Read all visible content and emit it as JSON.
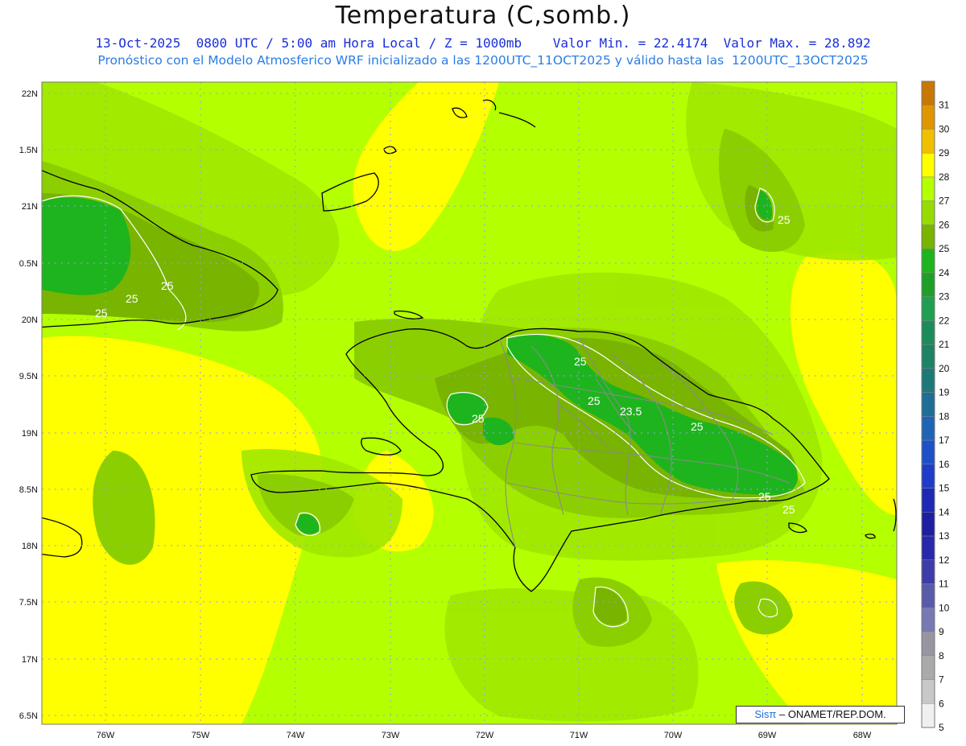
{
  "header": {
    "title": "Temperatura (C,somb.)",
    "line1": "13-Oct-2025  0800 UTC / 5:00 am Hora Local / Z = 1000mb    Valor Min. = 22.4174  Valor Max. = 28.892",
    "line2": "Pronóstico con el Modelo Atmosferico WRF inicializado a las 1200UTC_11OCT2025 y válido hasta las  1200UTC_13OCT2025"
  },
  "lat_labels": [
    "22N",
    "1.5N",
    "21N",
    "0.5N",
    "20N",
    "9.5N",
    "19N",
    "8.5N",
    "18N",
    "7.5N",
    "17N",
    "6.5N"
  ],
  "lon_labels": [
    "76W",
    "75W",
    "74W",
    "73W",
    "72W",
    "71W",
    "70W",
    "69W",
    "68W"
  ],
  "contour_labels": [
    "25",
    "25",
    "25",
    "25",
    "25",
    "25",
    "25",
    "23.5",
    "25",
    "25",
    "25"
  ],
  "colorbar": {
    "labels": [
      "31",
      "30",
      "29",
      "28",
      "27",
      "26",
      "25",
      "24",
      "23",
      "22",
      "21",
      "20",
      "19",
      "18",
      "17",
      "16",
      "15",
      "14",
      "13",
      "12",
      "11",
      "10",
      "9",
      "8",
      "7",
      "6",
      "5"
    ],
    "colors": [
      "#c87800",
      "#e09600",
      "#f0c000",
      "#ffff00",
      "#b4ff00",
      "#96dc00",
      "#78b400",
      "#1eb41e",
      "#1ea028",
      "#1ea050",
      "#1e8c5a",
      "#1e8264",
      "#1e7878",
      "#1e6e96",
      "#1e64b4",
      "#1e50c8",
      "#1e3cc8",
      "#1e28b4",
      "#1e1ea0",
      "#2828aa",
      "#3c3caa",
      "#5a5aaa",
      "#7878b4",
      "#9696a0",
      "#aaaaaa",
      "#c8c8c8",
      "#f0f0f0"
    ]
  },
  "credit": {
    "sis": "Sisπ",
    "rest": " –  ONAMET/REP.DOM."
  }
}
